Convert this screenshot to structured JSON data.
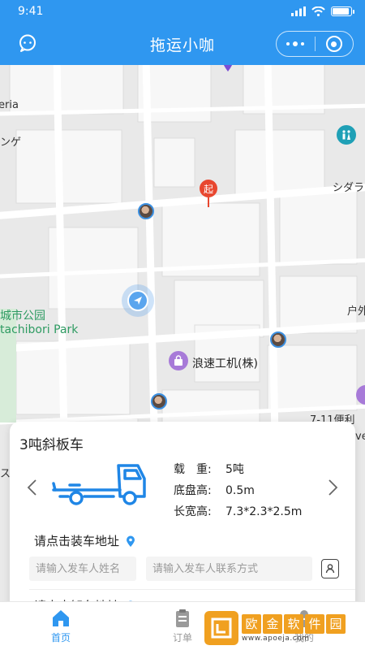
{
  "status_bar": {
    "time": "9:41",
    "battery_level": 0.9
  },
  "navbar": {
    "title": "拖运小咖",
    "left_icon": "chat-bubble-icon",
    "menu_icon": "more-dots-icon",
    "close_icon": "target-circle-icon"
  },
  "map": {
    "labels": {
      "eria": "eria",
      "nge": "ンゲ",
      "shidara": "シダラ",
      "park_cn": "城市公园",
      "park_en": "tachibori Park",
      "hu": "户外",
      "shop": "浪速工机(株)",
      "shop_right": "7-11便利",
      "right_fragment_1": "ve",
      "right_fragment_2": "ス"
    },
    "start_marker_label": "起"
  },
  "vehicle_card": {
    "name": "3吨斜板车",
    "specs": [
      {
        "label": "载　重:",
        "value": "5吨"
      },
      {
        "label": "底盘高:",
        "value": "0.5m"
      },
      {
        "label": "长宽高:",
        "value": "7.3*2.3*2.5m"
      }
    ],
    "load_address_label": "请点击装车地址",
    "sender_name_placeholder": "请输入发车人姓名",
    "sender_phone_placeholder": "请输入发车人联系方式",
    "unload_address_label": "请点击卸车地址"
  },
  "tabbar": {
    "tabs": [
      {
        "label": "首页",
        "icon": "home-icon"
      },
      {
        "label": "订单",
        "icon": "clipboard-icon"
      },
      {
        "label": "我的",
        "icon": "user-icon"
      }
    ]
  },
  "watermark": {
    "title": [
      "欧",
      "金",
      "软",
      "件",
      "园"
    ],
    "url": "www.apoeja.com"
  },
  "colors": {
    "primary": "#2f97f0",
    "start_marker": "#e8472f",
    "park_label": "#2e9b62",
    "watermark": "#f0a020"
  }
}
